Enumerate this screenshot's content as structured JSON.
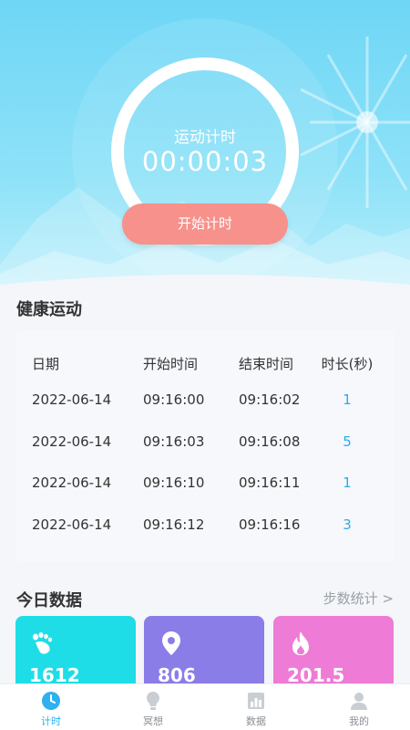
{
  "timer": {
    "title": "运动计时",
    "time": "00:00:03",
    "start_label": "开始计时"
  },
  "health": {
    "section_title": "健康运动",
    "columns": [
      "日期",
      "开始时间",
      "结束时间",
      "时长(秒)"
    ],
    "rows": [
      [
        "2022-06-14",
        "09:16:00",
        "09:16:02",
        "1"
      ],
      [
        "2022-06-14",
        "09:16:03",
        "09:16:08",
        "5"
      ],
      [
        "2022-06-14",
        "09:16:10",
        "09:16:11",
        "1"
      ],
      [
        "2022-06-14",
        "09:16:12",
        "09:16:16",
        "3"
      ]
    ]
  },
  "today": {
    "section_title": "今日数据",
    "link_label": "步数统计 >",
    "cards": [
      {
        "icon": "footprint-icon",
        "value": "1612",
        "color": "#1fdde6"
      },
      {
        "icon": "location-pin-icon",
        "value": "806",
        "color": "#8a7de8"
      },
      {
        "icon": "flame-icon",
        "value": "201.5",
        "color": "#ee7bd6"
      }
    ]
  },
  "tabs": [
    {
      "label": "计时",
      "icon": "clock-icon",
      "active": true
    },
    {
      "label": "冥想",
      "icon": "lightbulb-icon",
      "active": false
    },
    {
      "label": "数据",
      "icon": "bar-chart-icon",
      "active": false
    },
    {
      "label": "我的",
      "icon": "user-icon",
      "active": false
    }
  ],
  "colors": {
    "accent": "#2fb0f0",
    "button": "#f7918b",
    "hero": "#6ed6f6"
  }
}
